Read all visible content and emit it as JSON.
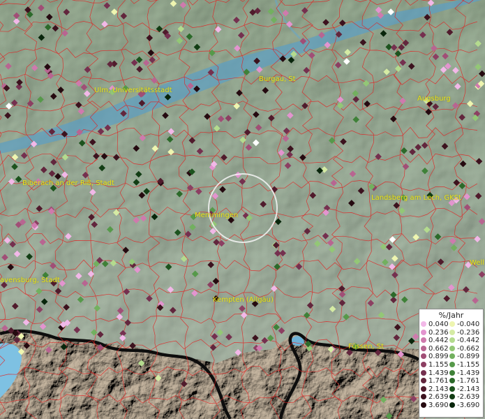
{
  "map": {
    "place_labels": [
      {
        "name": "Ulm, Universitätsstadt",
        "pos": [
          135,
          124
        ]
      },
      {
        "name": "Burgau, St",
        "pos": [
          371,
          108
        ]
      },
      {
        "name": "Augsburg",
        "pos": [
          598,
          136
        ]
      },
      {
        "name": "Biberach an der Riß, Stadt",
        "pos": [
          32,
          257
        ]
      },
      {
        "name": "Landsberg am Lech, GKSt",
        "pos": [
          532,
          278
        ]
      },
      {
        "name": "Memmingen",
        "pos": [
          279,
          303
        ]
      },
      {
        "name": "Well",
        "pos": [
          673,
          371
        ]
      },
      {
        "name": "avensburg, Stadt",
        "pos": [
          0,
          396
        ]
      },
      {
        "name": "Kempten (Allgäu)",
        "pos": [
          305,
          424
        ]
      },
      {
        "name": "Füssen, St",
        "pos": [
          499,
          491
        ]
      }
    ]
  },
  "legend": {
    "title": "%/Jahr",
    "positive": [
      {
        "value": "0.040",
        "color": "#f2b8e8"
      },
      {
        "value": "0.236",
        "color": "#e394cf"
      },
      {
        "value": "0.442",
        "color": "#cf7aad"
      },
      {
        "value": "0.662",
        "color": "#b86591"
      },
      {
        "value": "0.899",
        "color": "#a14e76"
      },
      {
        "value": "1.155",
        "color": "#8c3f62"
      },
      {
        "value": "1.439",
        "color": "#75304f"
      },
      {
        "value": "1.761",
        "color": "#62263d"
      },
      {
        "value": "2.143",
        "color": "#501b2c"
      },
      {
        "value": "2.639",
        "color": "#3c121e"
      },
      {
        "value": "3.690",
        "color": "#250a10"
      }
    ],
    "negative": [
      {
        "value": "-0.040",
        "color": "#eef5b0"
      },
      {
        "value": "-0.236",
        "color": "#d5eba4"
      },
      {
        "value": "-0.442",
        "color": "#b4db8e"
      },
      {
        "value": "-0.662",
        "color": "#93c776"
      },
      {
        "value": "-0.899",
        "color": "#72b05f"
      },
      {
        "value": "-1.155",
        "color": "#56994a"
      },
      {
        "value": "-1.439",
        "color": "#3f8138"
      },
      {
        "value": "-1.761",
        "color": "#2c6a2a"
      },
      {
        "value": "-2.143",
        "color": "#1d531e"
      },
      {
        "value": "-2.639",
        "color": "#123d14"
      },
      {
        "value": "-3.690",
        "color": "#08250b"
      }
    ]
  }
}
